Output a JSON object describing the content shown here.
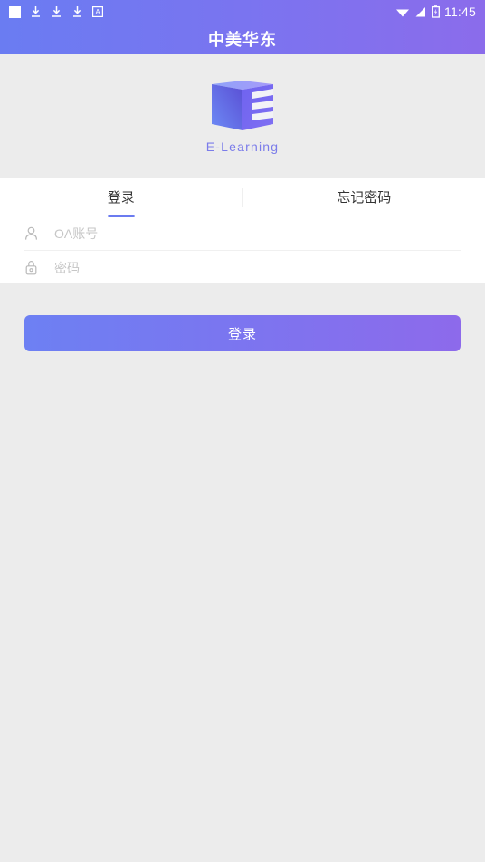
{
  "statusbar": {
    "time": "11:45",
    "icons": {
      "stop": "stop-square-icon",
      "download1": "download-icon",
      "download2": "download-icon",
      "download3": "download-icon",
      "keyboard": "keyboard-a-icon",
      "wifi": "wifi-icon",
      "signal": "cellular-signal-icon",
      "battery": "battery-charging-icon"
    }
  },
  "header": {
    "title": "中美华东",
    "gradient_start": "#6a7cf2",
    "gradient_end": "#8b6ceb"
  },
  "logo": {
    "icon": "e-learning-book-logo",
    "caption": "E-Learning",
    "caption_color": "#7b7cea"
  },
  "tabs": [
    {
      "label": "登录",
      "active": true,
      "name": "tab-login"
    },
    {
      "label": "忘记密码",
      "active": false,
      "name": "tab-forgot-password"
    }
  ],
  "tab_indicator_color": "#6b7bf0",
  "form": {
    "account": {
      "icon": "user-icon",
      "value": "",
      "placeholder": "OA账号"
    },
    "password": {
      "icon": "lock-icon",
      "value": "",
      "placeholder": "密码"
    }
  },
  "actions": {
    "login_label": "登录",
    "login_gradient_start": "#6d80f3",
    "login_gradient_end": "#8d6aeb"
  },
  "theme": {
    "page_background": "#ececec",
    "card_background": "#ffffff",
    "placeholder_color": "#c6c6c6"
  }
}
